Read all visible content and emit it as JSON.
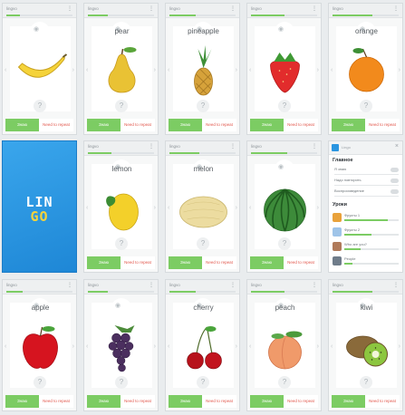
{
  "card_ui": {
    "known_label": "Знаю",
    "repeat_label": "Need to repeat",
    "hint": "?",
    "status_title": "lingvo",
    "left_arrow": "‹",
    "right_arrow": "›",
    "menu_dots": "⋮"
  },
  "cards": [
    {
      "word": "",
      "fruit": "banana",
      "progress": 0.2
    },
    {
      "word": "pear",
      "fruit": "pear",
      "progress": 0.3
    },
    {
      "word": "pineapple",
      "fruit": "pineapple",
      "progress": 0.4
    },
    {
      "word": "",
      "fruit": "strawberry",
      "progress": 0.5
    },
    {
      "word": "orange",
      "fruit": "orange",
      "progress": 0.6
    },
    {
      "word": "lemon",
      "fruit": "lemon",
      "progress": 0.35
    },
    {
      "word": "melon",
      "fruit": "melon",
      "progress": 0.45
    },
    {
      "word": "",
      "fruit": "watermelon",
      "progress": 0.55
    },
    {
      "word": "apple",
      "fruit": "apple",
      "progress": 0.25
    },
    {
      "word": "",
      "fruit": "grapes",
      "progress": 0.3
    },
    {
      "word": "cherry",
      "fruit": "cherry",
      "progress": 0.4
    },
    {
      "word": "peach",
      "fruit": "peach",
      "progress": 0.5
    },
    {
      "word": "kiwi",
      "fruit": "kiwi",
      "progress": 0.6
    }
  ],
  "splash": {
    "logo_top": "LIN",
    "logo_bottom": "GO"
  },
  "menu": {
    "title": "Lingo",
    "close": "×",
    "main_section": "Главное",
    "settings_rows": [
      "Я знаю",
      "Надо повторить",
      "Воспроизведение"
    ],
    "lessons_section": "Уроки",
    "lessons": [
      {
        "label": "Фрукты 1",
        "progress": 0.8,
        "thumb": "#e9a23b"
      },
      {
        "label": "Фрукты 2",
        "progress": 0.5,
        "thumb": "#9fc4e8"
      },
      {
        "label": "Who are you?",
        "progress": 0.3,
        "thumb": "#b07a5a"
      },
      {
        "label": "People",
        "progress": 0.15,
        "thumb": "#6f7c8a"
      }
    ]
  },
  "colors": {
    "accent_green": "#7ccc63",
    "repeat_red": "#e2574c",
    "splash_blue": "#2a95e0",
    "logo_yellow": "#f6d33c"
  }
}
